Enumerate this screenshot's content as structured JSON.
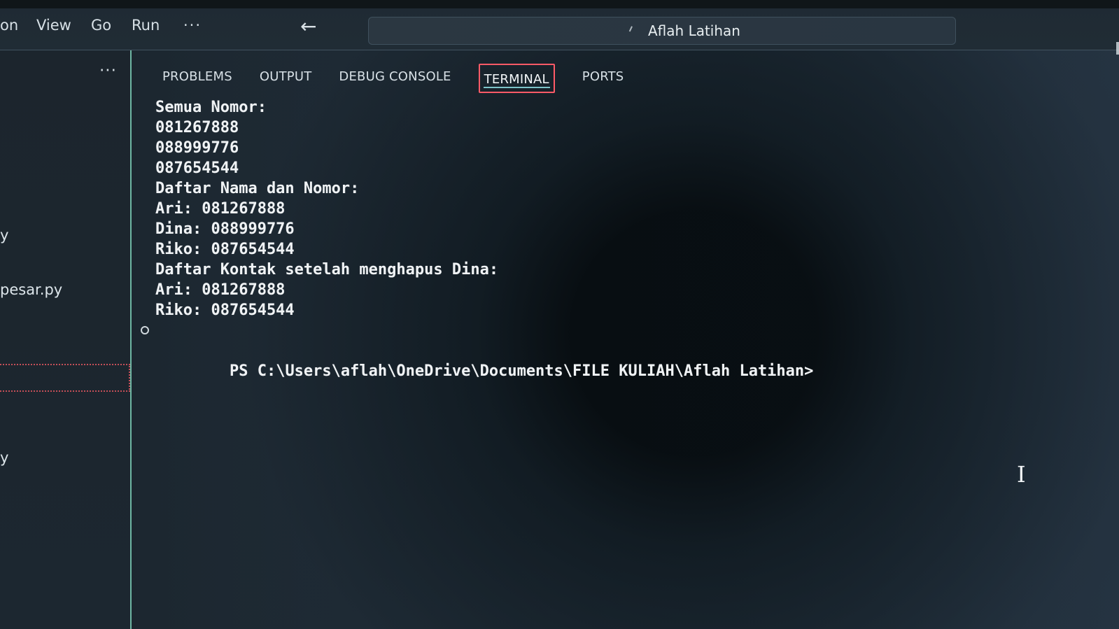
{
  "menu": {
    "items": [
      "on",
      "View",
      "Go",
      "Run",
      "···"
    ]
  },
  "search": {
    "title": "Aflah Latihan"
  },
  "sidebar": {
    "more": "···",
    "items": [
      "y",
      "pesar.py",
      "y"
    ]
  },
  "panel": {
    "tabs": [
      "PROBLEMS",
      "OUTPUT",
      "DEBUG CONSOLE",
      "TERMINAL",
      "PORTS"
    ],
    "terminal_lines": [
      "Semua Nomor:",
      "081267888",
      "088999776",
      "087654544",
      "Daftar Nama dan Nomor:",
      "Ari: 081267888",
      "Dina: 088999776",
      "Riko: 087654544",
      "Daftar Kontak setelah menghapus Dina:",
      "Ari: 081267888",
      "Riko: 087654544"
    ],
    "prompt": "PS C:\\Users\\aflah\\OneDrive\\Documents\\FILE KULIAH\\Aflah Latihan>"
  },
  "cursor": {
    "glyph": "I"
  }
}
